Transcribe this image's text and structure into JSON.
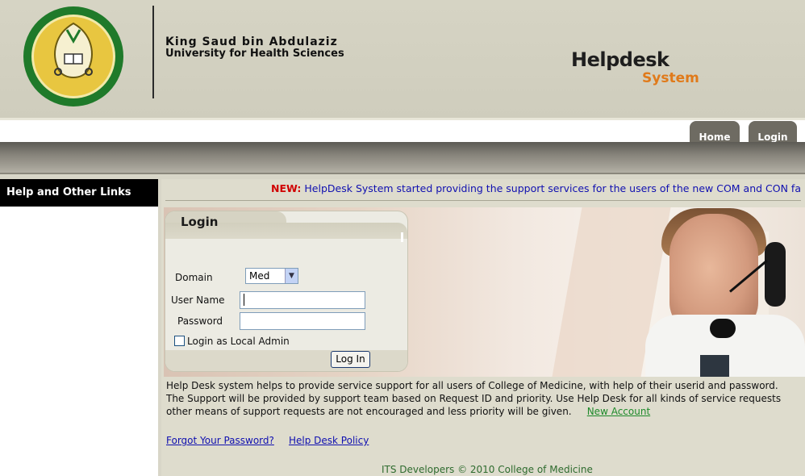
{
  "header": {
    "university_line1": "King Saud bin Abdulaziz",
    "university_line2": "University for Health Sciences",
    "brand_main": "Helpdesk",
    "brand_sub": "System"
  },
  "nav": {
    "tabs": [
      {
        "label": "Home"
      },
      {
        "label": "Login"
      }
    ]
  },
  "sidebar": {
    "title": "Help and Other Links"
  },
  "news": {
    "label": "NEW:",
    "text": "HelpDesk System started providing the support services for the users of the new COM and CON fa"
  },
  "login": {
    "title": "Login",
    "domain_label": "Domain",
    "domain_value": "Med",
    "username_label": "User Name",
    "username_value": "",
    "password_label": "Password",
    "password_value": "",
    "local_admin_label": "Login as Local Admin",
    "local_admin_checked": false,
    "submit_label": "Log In"
  },
  "description": {
    "text": "Help Desk system helps to provide service support for all users of College of Medicine, with help of their userid and password. The Support will be provided by support team based on Request ID and priority. Use Help Desk for all kinds of service requests other means of support requests are not encouraged and less priority will be given.",
    "new_account_link": "New Account"
  },
  "links": {
    "forgot_password": "Forgot Your Password?",
    "policy": "Help Desk Policy"
  },
  "footer": {
    "text": "ITS Developers © 2010 College of Medicine"
  },
  "colors": {
    "accent_orange": "#e07a1a",
    "news_red": "#d00000",
    "link_blue": "#1010b0",
    "link_green": "#1e8a2a",
    "tab_gray": "#6e6b62"
  }
}
